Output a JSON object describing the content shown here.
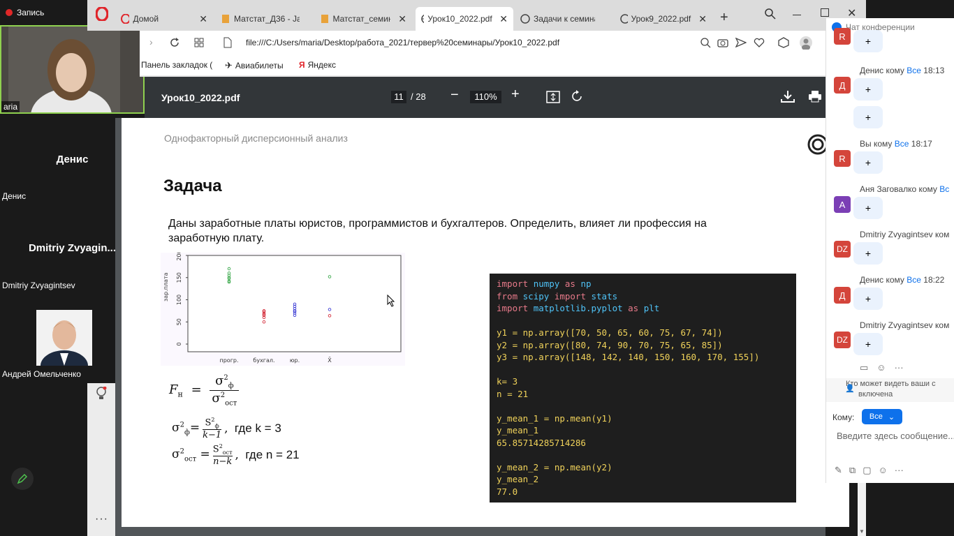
{
  "zoom": {
    "recording_label": "Запись",
    "tiles": [
      {
        "name": "aria"
      },
      {
        "big": "Денис",
        "name": "Денис"
      },
      {
        "big": "Dmitriy  Zvyagin...",
        "name": "Dmitriy Zvyagintsev"
      },
      {
        "name": "Андрей Омельченко"
      }
    ]
  },
  "browser": {
    "tabs": [
      {
        "label": "Домой"
      },
      {
        "label": "Матстат_Д36 - Ja"
      },
      {
        "label": "Матстат_семинар"
      },
      {
        "label": "Урок10_2022.pdf"
      },
      {
        "label": "Задачи к семина"
      },
      {
        "label": "Урок9_2022.pdf"
      }
    ],
    "url": "file:///C:/Users/maria/Desktop/работа_2021/тервер%20семинары/Урок10_2022.pdf",
    "bookmarks": [
      "Панель закладок (",
      "Авиабилеты",
      "Яндекс"
    ]
  },
  "pdf": {
    "filename": "Урок10_2022.pdf",
    "page_current": "11",
    "page_total": "/ 28",
    "zoom": "110%",
    "header": "Однофакторный дисперсионный анализ",
    "title": "Задача",
    "problem_line1": "Даны заработные платы юристов, программистов и бухгалтеров. Определить, влияет ли профессия на",
    "problem_line2": "заработную плату.",
    "formula_k": "где k = 3",
    "formula_n": "где n = 21",
    "code_lines": [
      "import numpy as np",
      "from scipy import stats",
      "import matplotlib.pyplot as plt",
      "",
      "y1 = np.array([70, 50, 65, 60, 75, 67, 74])",
      "y2 = np.array([80, 74, 90, 70, 75, 65, 85])",
      "y3 = np.array([148, 142, 140, 150, 160, 170, 155])",
      "",
      "k= 3",
      "n = 21",
      "",
      "y_mean_1 = np.mean(y1)",
      "y_mean_1",
      "65.85714285714286",
      "",
      "y_mean_2 = np.mean(y2)",
      "y_mean_2",
      "77.0"
    ]
  },
  "chart_data": {
    "type": "scatter",
    "ylabel": "зар.плата",
    "categories": [
      "прогр.",
      "бухгал.",
      "юр.",
      "X̄"
    ],
    "ylim": [
      0,
      200
    ],
    "yticks": [
      0,
      50,
      100,
      150,
      200
    ],
    "series": [
      {
        "color": "#3aa84b",
        "category": "прогр.",
        "values": [
          140,
          142,
          148,
          150,
          155,
          160,
          170
        ]
      },
      {
        "color": "#d42c3a",
        "category": "бухгал.",
        "values": [
          50,
          60,
          65,
          67,
          70,
          74,
          75
        ]
      },
      {
        "color": "#3a3ad4",
        "category": "юр.",
        "values": [
          65,
          70,
          74,
          75,
          80,
          85,
          90
        ]
      },
      {
        "color": "#3aa84b",
        "category": "X̄",
        "values": [
          152
        ]
      },
      {
        "color": "#3a3ad4",
        "category": "X̄",
        "values": [
          78
        ]
      },
      {
        "color": "#d42c3a",
        "category": "X̄",
        "values": [
          64
        ]
      }
    ]
  },
  "chat": {
    "title": "Чат конференции",
    "messages": [
      {
        "avatar": "R",
        "sender": "",
        "to": "",
        "time": "",
        "bubble": "+"
      },
      {
        "avatar": "Д",
        "sender": "Денис кому",
        "to": "Все",
        "time": "18:13",
        "bubble": "+"
      },
      {
        "avatar": "",
        "sender": "",
        "to": "",
        "time": "",
        "bubble": "+"
      },
      {
        "avatar": "R",
        "sender": "Вы кому",
        "to": "Все",
        "time": "18:17",
        "bubble": "+"
      },
      {
        "avatar": "А",
        "sender": "Аня Заговалко кому",
        "to": "Вс",
        "time": "",
        "bubble": "+"
      },
      {
        "avatar": "DZ",
        "sender": "Dmitriy Zvyagintsev ком",
        "to": "",
        "time": "",
        "bubble": "+"
      },
      {
        "avatar": "Д",
        "sender": "Денис кому",
        "to": "Все",
        "time": "18:22",
        "bubble": "+"
      },
      {
        "avatar": "DZ",
        "sender": "Dmitriy Zvyagintsev ком",
        "to": "",
        "time": "",
        "bubble": "+"
      }
    ],
    "visibility_note_1": "Кто может видеть ваши с",
    "visibility_note_2": "включена",
    "to_label": "Кому:",
    "to_value": "Все",
    "input_placeholder": "Введите здесь сообщение..."
  },
  "colors": {
    "pdf_toolbar": "#323639",
    "chat_accent": "#0e71eb",
    "code_bg": "#1e1e1e"
  }
}
